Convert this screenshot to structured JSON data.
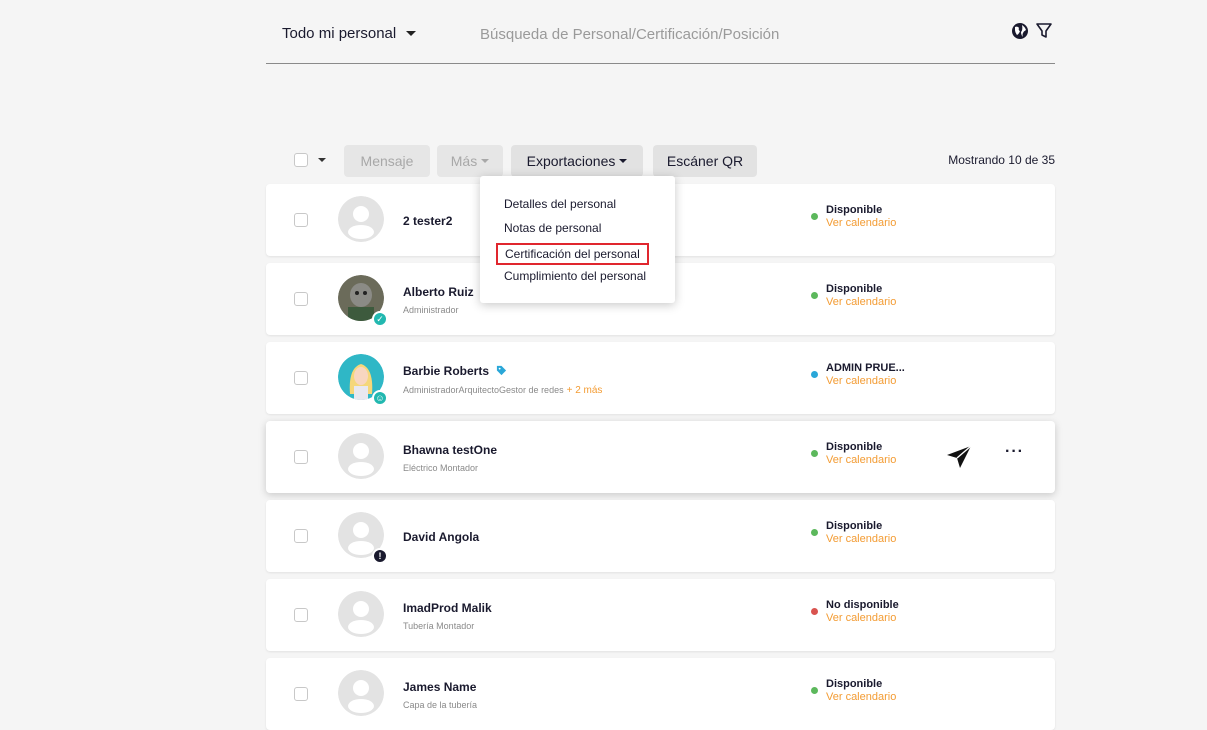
{
  "header": {
    "filter_label": "Todo mi personal",
    "search_placeholder": "Búsqueda de Personal/Certificación/Posición",
    "icons": [
      "globe-icon",
      "filter-icon"
    ]
  },
  "toolbar": {
    "message_label": "Mensaje",
    "more_label": "Más",
    "exports_label": "Exportaciones",
    "qr_label": "Escáner QR",
    "showing_text": "Mostrando 10 de 35"
  },
  "exports_menu": {
    "items": [
      "Detalles del personal",
      "Notas de personal",
      "Certificación del personal",
      "Cumplimiento del personal"
    ],
    "highlighted_index": 2
  },
  "rows": [
    {
      "name": "2 tester2",
      "role": "",
      "status": "Disponible",
      "status_color": "#5cb85c",
      "calendar": "Ver calendario"
    },
    {
      "name": "Alberto Ruiz",
      "role": "Administrador",
      "status": "Disponible",
      "status_color": "#5cb85c",
      "calendar": "Ver calendario"
    },
    {
      "name": "Barbie Roberts",
      "role": "AdministradorArquitectoGestor de redes",
      "role_more": "+ 2 más",
      "status": "ADMIN PRUE...",
      "status_color": "#2aa7d8",
      "calendar": "Ver calendario"
    },
    {
      "name": "Bhawna testOne",
      "role": "Eléctrico Montador",
      "status": "Disponible",
      "status_color": "#5cb85c",
      "calendar": "Ver calendario"
    },
    {
      "name": "David Angola",
      "role": "",
      "status": "Disponible",
      "status_color": "#5cb85c",
      "calendar": "Ver calendario"
    },
    {
      "name": "ImadProd Malik",
      "role": "Tubería Montador",
      "status": "No disponible",
      "status_color": "#d9534f",
      "calendar": "Ver calendario"
    },
    {
      "name": "James Name",
      "role": "Capa de la tubería",
      "status": "Disponible",
      "status_color": "#5cb85c",
      "calendar": "Ver calendario"
    }
  ],
  "row_actions": {
    "more_glyph": "···"
  },
  "colors": {
    "accent": "#f39c34",
    "highlight_border": "#e0262e",
    "teal_badge": "#22b8b0"
  }
}
